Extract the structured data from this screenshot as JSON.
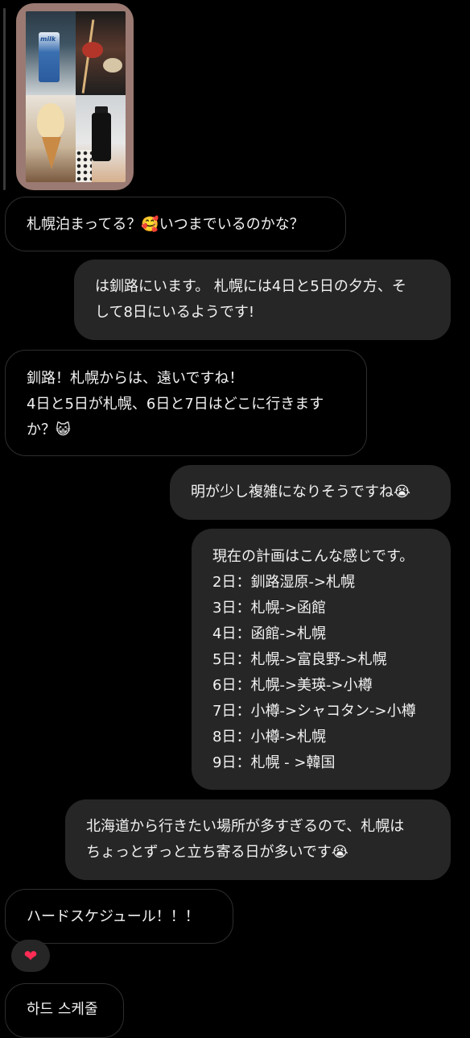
{
  "shared_post": {
    "milk_label": "milk"
  },
  "messages": [
    {
      "id": "m1",
      "direction": "incoming",
      "lines": [
        "札幌泊まってる？🥰いつまでいるのかな？"
      ]
    },
    {
      "id": "m2",
      "direction": "outgoing",
      "lines": [
        "は釧路にいます。 札幌には4日と5日の夕方、そ",
        "して8日にいるようです!"
      ]
    },
    {
      "id": "m3",
      "direction": "incoming",
      "lines": [
        "釧路！札幌からは、遠いですね！",
        "4日と5日が札幌、6日と7日はどこに行きます",
        "か？😺"
      ]
    },
    {
      "id": "m4",
      "direction": "outgoing",
      "lines": [
        "明が少し複雑になりそうですね😭"
      ]
    },
    {
      "id": "m5",
      "direction": "outgoing",
      "lines": [
        "現在の計画はこんな感じです。",
        "2日：釧路湿原->札幌",
        "3日：札幌->函館",
        "4日：函館->札幌",
        "5日：札幌->富良野->札幌",
        "6日：札幌->美瑛->小樽",
        "7日：小樽->シャコタン->小樽",
        "8日：小樽->札幌",
        "9日：札幌 - >韓国"
      ]
    },
    {
      "id": "m6",
      "direction": "outgoing",
      "lines": [
        "北海道から行きたい場所が多すぎるので、札幌は",
        "ちょっとずっと立ち寄る日が多いです😭"
      ]
    },
    {
      "id": "m7",
      "direction": "incoming",
      "lines": [
        "ハードスケジュール！！！"
      ]
    },
    {
      "id": "m8",
      "direction": "incoming",
      "lines": [
        "하드 스케줄"
      ]
    }
  ],
  "reaction": {
    "emoji": "❤",
    "icon": "heart-icon",
    "color": "#ff2d55"
  },
  "colors": {
    "background": "#000000",
    "outgoing_bubble": "#262626",
    "incoming_border": "#2e2e2e",
    "text": "#f2f2f2"
  }
}
